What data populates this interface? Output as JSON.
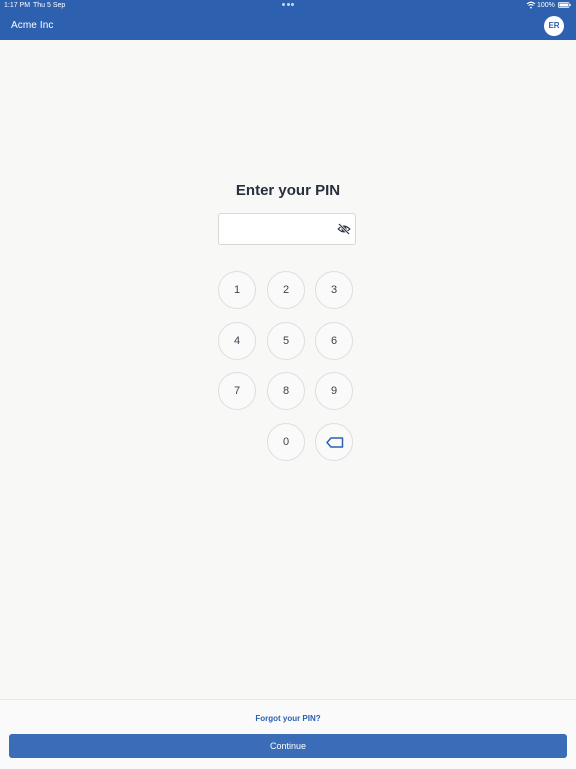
{
  "status_bar": {
    "time": "1:17 PM",
    "date": "Thu 5 Sep",
    "battery": "100%"
  },
  "header": {
    "title": "Acme Inc",
    "avatar_initials": "ER"
  },
  "pin": {
    "title": "Enter your PIN",
    "value": "",
    "placeholder": ""
  },
  "keypad": {
    "keys": [
      "1",
      "2",
      "3",
      "4",
      "5",
      "6",
      "7",
      "8",
      "9",
      "0"
    ]
  },
  "footer": {
    "forgot_label": "Forgot your PIN?",
    "continue_label": "Continue"
  },
  "colors": {
    "header_bg": "#2d61b0",
    "accent": "#2d61b0",
    "continue_bg": "#3a6cb7",
    "page_bg": "#f8f8f7"
  },
  "icons": {
    "visibility_toggle": "eye-off-icon",
    "backspace": "backspace-icon",
    "wifi": "wifi-icon",
    "battery": "battery-icon",
    "more": "more-dots-icon"
  }
}
